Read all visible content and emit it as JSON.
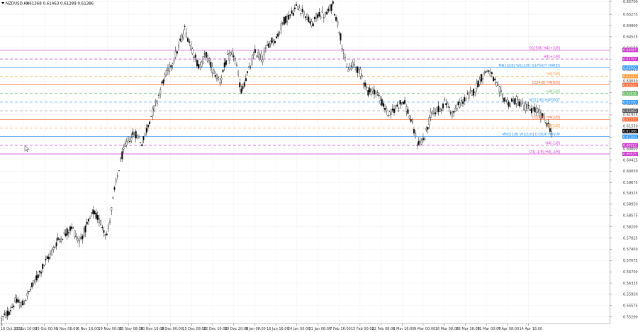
{
  "header": {
    "symbol_label": "NZDUSD,H4",
    "ohlc_label": "0.61368 0.61463 0.61289 0.61386"
  },
  "chart_data": {
    "type": "candlestick",
    "symbol": "NZDUSD",
    "timeframe": "H4",
    "ohlc": {
      "open": 0.61368,
      "high": 0.61463,
      "low": 0.61289,
      "close": 0.61386
    },
    "ylim": [
      0.5498,
      0.6575
    ],
    "y_ticks": [
      0.657,
      0.65275,
      0.649,
      0.64525,
      0.6415,
      0.63775,
      0.63425,
      0.6305,
      0.62675,
      0.623,
      0.61925,
      0.6155,
      0.61175,
      0.608,
      0.60425,
      0.6005,
      0.59675,
      0.59325,
      0.5895,
      0.58575,
      0.582,
      0.57825,
      0.5745,
      0.57075,
      0.567,
      0.56325,
      0.5595,
      0.55575,
      0.552
    ],
    "x_ticks": [
      "10 Oct 2022",
      "17 Oct 16:00",
      "25 Oct 00:00",
      "1 Nov 08:00",
      "8 Nov 16:00",
      "16 Nov 00:00",
      "23 Nov 08:00",
      "30 Nov 16:00",
      "8 Dec 00:00",
      "15 Dec 08:00",
      "22 Dec 16:00",
      "30 Dec 20:00",
      "9 Jan 08:00",
      "16 Jan 16:00",
      "24 Jan 00:00",
      "31 Jan 08:00",
      "7 Feb 16:00",
      "15 Feb 00:00",
      "22 Feb 08:00",
      "1 Mar 16:00",
      "9 Mar 00:00",
      "16 Mar 08:00",
      "23 Mar 16:00",
      "31 Mar 00:00",
      "7 Apr 08:00",
      "14 Apr 16:00"
    ],
    "price_path": [
      [
        0,
        0.5511
      ],
      [
        1,
        0.5535
      ],
      [
        2,
        0.5572
      ],
      [
        3,
        0.556
      ],
      [
        4,
        0.5605
      ],
      [
        5,
        0.565
      ],
      [
        6,
        0.5692
      ],
      [
        7,
        0.573
      ],
      [
        8,
        0.5775
      ],
      [
        9,
        0.5795
      ],
      [
        10,
        0.582
      ],
      [
        11,
        0.577
      ],
      [
        12,
        0.5815
      ],
      [
        13,
        0.5868
      ],
      [
        14,
        0.5838
      ],
      [
        15,
        0.579
      ],
      [
        16,
        0.5935
      ],
      [
        17,
        0.605
      ],
      [
        18,
        0.611
      ],
      [
        19,
        0.613
      ],
      [
        20,
        0.6098
      ],
      [
        21,
        0.6175
      ],
      [
        22,
        0.6235
      ],
      [
        23,
        0.631
      ],
      [
        24,
        0.6355
      ],
      [
        25,
        0.641
      ],
      [
        26,
        0.6478
      ],
      [
        27,
        0.6415
      ],
      [
        28,
        0.635
      ],
      [
        29,
        0.6395
      ],
      [
        30,
        0.634
      ],
      [
        31,
        0.6305
      ],
      [
        32,
        0.638
      ],
      [
        33,
        0.6395
      ],
      [
        34,
        0.627
      ],
      [
        35,
        0.6335
      ],
      [
        36,
        0.64
      ],
      [
        37,
        0.638
      ],
      [
        38,
        0.6435
      ],
      [
        39,
        0.6448
      ],
      [
        40,
        0.6505
      ],
      [
        41,
        0.6525
      ],
      [
        42,
        0.6555
      ],
      [
        43,
        0.653
      ],
      [
        44,
        0.649
      ],
      [
        45,
        0.653
      ],
      [
        46,
        0.6523
      ],
      [
        47,
        0.656
      ],
      [
        48,
        0.6465
      ],
      [
        49,
        0.634
      ],
      [
        50,
        0.636
      ],
      [
        51,
        0.633
      ],
      [
        52,
        0.627
      ],
      [
        53,
        0.6275
      ],
      [
        54,
        0.623
      ],
      [
        55,
        0.619
      ],
      [
        56,
        0.622
      ],
      [
        57,
        0.624
      ],
      [
        58,
        0.618
      ],
      [
        59,
        0.6095
      ],
      [
        60,
        0.6115
      ],
      [
        61,
        0.62
      ],
      [
        62,
        0.621
      ],
      [
        63,
        0.6235
      ],
      [
        64,
        0.6195
      ],
      [
        65,
        0.623
      ],
      [
        66,
        0.625
      ],
      [
        67,
        0.6272
      ],
      [
        68,
        0.6315
      ],
      [
        69,
        0.6345
      ],
      [
        70,
        0.63
      ],
      [
        71,
        0.6255
      ],
      [
        72,
        0.623
      ],
      [
        73,
        0.624
      ],
      [
        74,
        0.6225
      ],
      [
        75,
        0.621
      ],
      [
        76,
        0.6205
      ],
      [
        77,
        0.618
      ],
      [
        78,
        0.6139
      ]
    ],
    "grid": true,
    "levels": [
      {
        "label": "D1[5/8] H4[+2/8]",
        "price": 0.64075,
        "color": "#cc33cc",
        "style": "solid"
      },
      {
        "label": "H4[+1/8]",
        "price": 0.63787,
        "color": "#cc33cc",
        "style": "dash"
      },
      {
        "label": "MN1[2/8] W1[2/8] D1PIVOT H4RES",
        "price": 0.635,
        "color": "#3399ff",
        "style": "solid"
      },
      {
        "label": "H4[7/8]",
        "price": 0.63213,
        "color": "#ff9933",
        "style": "dash"
      },
      {
        "label": "D1[4/8] H4[6/8]",
        "price": 0.62925,
        "color": "#ff6633",
        "style": "solid"
      },
      {
        "label": "H4[5/8]",
        "price": 0.62638,
        "color": "#66bb66",
        "style": "dash"
      },
      {
        "label": "W1[1/8] H4PIVOT",
        "price": 0.6235,
        "color": "#3399ff",
        "style": "dash"
      },
      {
        "label": "",
        "price": 0.62062,
        "color": "#999999",
        "style": "dash"
      },
      {
        "label": "D1[3/8] H4[2/8]",
        "price": 0.61775,
        "color": "#ff6633",
        "style": "solid"
      },
      {
        "label": "H4[1/8]",
        "price": 0.61488,
        "color": "#ff9933",
        "style": "dash"
      },
      {
        "label": "MN1[1/8] W1[1/8] D1SUP H4SUP",
        "price": 0.612,
        "color": "#3399ff",
        "style": "solid"
      },
      {
        "label": "H4[-1/8]",
        "price": 0.60912,
        "color": "#cc33cc",
        "style": "dash"
      },
      {
        "label": "D1[-1/8] H4[-2/8]",
        "price": 0.60625,
        "color": "#cc33cc",
        "style": "solid"
      }
    ],
    "price_tags": [
      {
        "text": "0.64087",
        "price": 0.64087,
        "color": "#cc33cc"
      },
      {
        "text": "0.63787",
        "price": 0.63787,
        "color": "#cc33cc"
      },
      {
        "text": "0.63500",
        "price": 0.635,
        "color": "#3399ff"
      },
      {
        "text": "0.63213",
        "price": 0.63213,
        "color": "#ff9933"
      },
      {
        "text": "0.62925",
        "price": 0.62925,
        "color": "#ff6633"
      },
      {
        "text": "0.62638",
        "price": 0.62638,
        "color": "#66bb66"
      },
      {
        "text": "0.62350",
        "price": 0.6235,
        "color": "#3399ff"
      },
      {
        "text": "0.62062",
        "price": 0.62062,
        "color": "#555555"
      },
      {
        "text": "0.61775",
        "price": 0.61775,
        "color": "#ff6633"
      },
      {
        "text": "0.61386",
        "price": 0.61386,
        "color": "#000000"
      },
      {
        "text": "0.61200",
        "price": 0.612,
        "color": "#3399ff"
      },
      {
        "text": "0.60912",
        "price": 0.60912,
        "color": "#cc33cc"
      },
      {
        "text": "0.60625",
        "price": 0.60625,
        "color": "#cc33cc"
      }
    ]
  }
}
